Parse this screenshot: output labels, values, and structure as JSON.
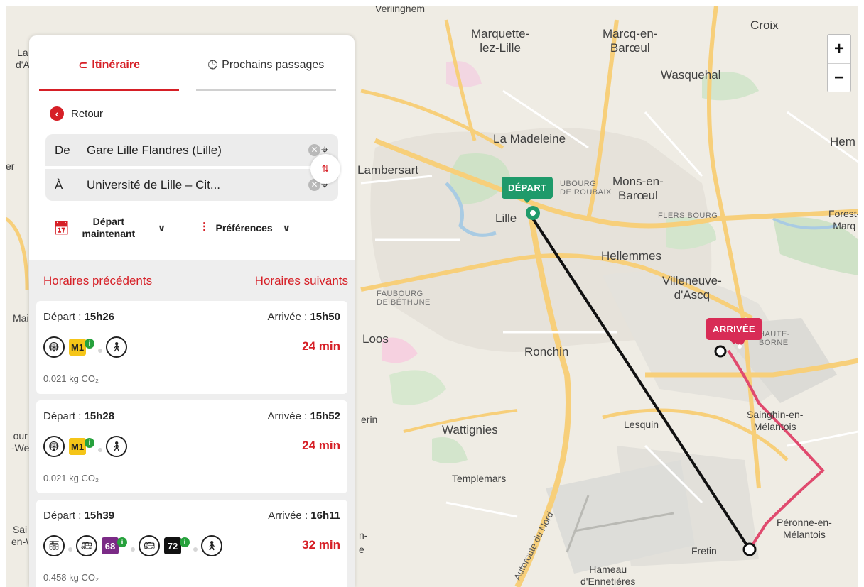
{
  "map": {
    "places": [
      {
        "name": "Verlinghem",
        "cls": "small"
      },
      {
        "name": "Marquette-\nlez-Lille"
      },
      {
        "name": "Marcq-en-\nBarœul"
      },
      {
        "name": "Croix"
      },
      {
        "name": "Wasquehal"
      },
      {
        "name": "La Madeleine"
      },
      {
        "name": "Hem"
      },
      {
        "name": "Lambersart"
      },
      {
        "name": "Mons-en-\nBarœul"
      },
      {
        "name": "Lille"
      },
      {
        "name": "Forest-\nMarq",
        "cls": "small"
      },
      {
        "name": "Hellemmes"
      },
      {
        "name": "Villeneuve-\nd'Ascq"
      },
      {
        "name": "Loos"
      },
      {
        "name": "Ronchin"
      },
      {
        "name": "Sainghin-en-\nMélantois",
        "cls": "small"
      },
      {
        "name": "Lesquin",
        "cls": "small"
      },
      {
        "name": "Wattignies"
      },
      {
        "name": "Templemars",
        "cls": "small"
      },
      {
        "name": "Péronne-en-\nMélantois",
        "cls": "small"
      },
      {
        "name": "Fretin",
        "cls": "small"
      },
      {
        "name": "Hameau\nd'Ennetières",
        "cls": "small"
      },
      {
        "name": "La\nd'A",
        "cls": "small"
      },
      {
        "name": "Mais",
        "cls": "small"
      },
      {
        "name": "our\n-We",
        "cls": "small"
      },
      {
        "name": "Sai\nen-\\",
        "cls": "small"
      },
      {
        "name": "erin",
        "cls": "small"
      },
      {
        "name": "er",
        "cls": "small"
      },
      {
        "name": "e",
        "cls": "small"
      },
      {
        "name": "n-",
        "cls": "small"
      }
    ],
    "districts": [
      "UBOURG\nDE ROUBAIX",
      "FLERS BOURG",
      "FAUBOURG\nDE BÉTHUNE",
      "HAUTE-\nBORNE"
    ],
    "road_label": "Autoroute du Nord",
    "zoom_in": "+",
    "zoom_out": "−",
    "depart_tag": "DÉPART",
    "arrivee_tag": "ARRIVÉE"
  },
  "panel": {
    "tab_itineraire": "Itinéraire",
    "tab_passages": "Prochains passages",
    "retour": "Retour",
    "from_prefix": "De",
    "from_value": "Gare Lille Flandres (Lille)",
    "to_prefix": "À",
    "to_value": "Université de Lille – Cit...",
    "depart_option": "Départ\nmaintenant",
    "prefs_option": "Préférences",
    "prev": "Horaires précédents",
    "next": "Horaires suivants"
  },
  "results": [
    {
      "depart_label": "Départ :",
      "depart": "15h26",
      "arrivee_label": "Arrivée :",
      "arrivee": "15h50",
      "duration": "24 min",
      "co2": "0.021 kg CO₂",
      "legs": [
        "metro",
        "M1",
        "walk"
      ]
    },
    {
      "depart_label": "Départ :",
      "depart": "15h28",
      "arrivee_label": "Arrivée :",
      "arrivee": "15h52",
      "duration": "24 min",
      "co2": "0.021 kg CO₂",
      "legs": [
        "metro",
        "M1",
        "walk"
      ]
    },
    {
      "depart_label": "Départ :",
      "depart": "15h39",
      "arrivee_label": "Arrivée :",
      "arrivee": "16h11",
      "duration": "32 min",
      "co2": "0.458 kg CO₂",
      "legs": [
        "tram",
        "bus",
        "68",
        "bus",
        "72",
        "walk"
      ]
    }
  ],
  "colors": {
    "accent": "#d61f26",
    "depart": "#1f9a6a",
    "arrivee": "#d82c56",
    "m1": "#f5c518",
    "l68": "#7b2a86",
    "l72": "#111111"
  }
}
